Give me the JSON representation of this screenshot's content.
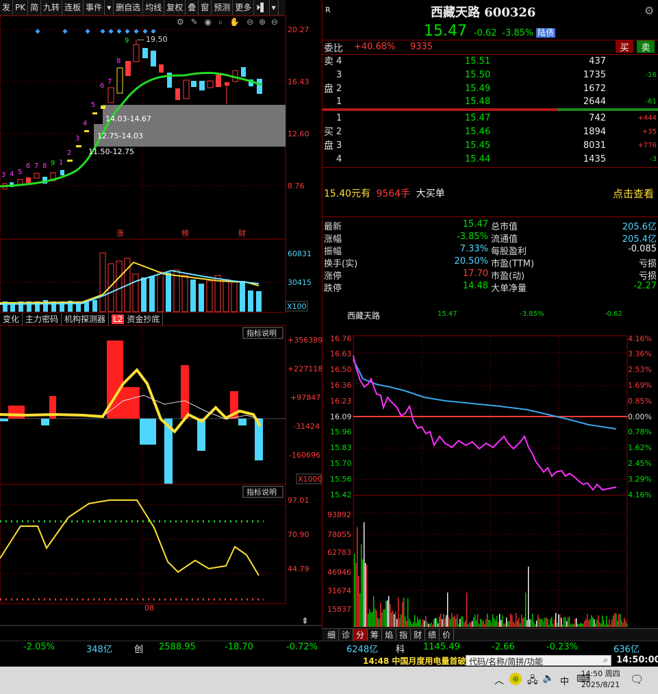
{
  "toolbar": {
    "items": [
      "发",
      "PK",
      "简",
      "九转",
      "连板",
      "事件",
      "▾",
      "|",
      "删自选",
      "均线",
      "复权",
      "叠",
      "窗",
      "预测",
      "更多",
      "⏵▌",
      "▾"
    ]
  },
  "kline": {
    "price_ticks": [
      "20.27",
      "16.43",
      "12.60",
      "8.76"
    ],
    "annotations": {
      "high": "19.50",
      "zone1": "14.03-14.67",
      "zone2": "12.75-14.03",
      "zone3": "11.50-12.75"
    },
    "markers": [
      "涨",
      "榜",
      "财"
    ],
    "nine_counts": [
      "3",
      "4",
      "5",
      "6",
      "7",
      "8",
      "9",
      "1",
      "2",
      "3",
      "4",
      "5",
      "6",
      "7",
      "8",
      "9"
    ]
  },
  "volume": {
    "ticks": [
      "60831",
      "30415"
    ],
    "unit": "X100"
  },
  "indicator_tabs": [
    "变化",
    "主力密码",
    "机构探测器",
    "L2",
    "资金抄底"
  ],
  "flow": {
    "button": "指标说明",
    "ticks": [
      "+356389",
      "+227118",
      "+97847",
      "-31424",
      "-160696"
    ],
    "unit": "X1000"
  },
  "osc": {
    "button": "指标说明",
    "ticks": [
      "97.01",
      "70.90",
      "44.79"
    ],
    "date_label": "08"
  },
  "header": {
    "badge": "R",
    "name": "西藏天路",
    "code": "600326",
    "price": "15.47",
    "change": "-0.62",
    "pct": "-3.85%",
    "tag": "陆债"
  },
  "weibi": {
    "label": "委比",
    "pct": "+40.68%",
    "diff": "9335",
    "buy_btn": "买",
    "sell_btn": "卖"
  },
  "asks": [
    {
      "side": "卖",
      "lvl": "4",
      "price": "15.51",
      "vol": "437",
      "chg": ""
    },
    {
      "side": "",
      "lvl": "3",
      "price": "15.50",
      "vol": "1735",
      "chg": "-16"
    },
    {
      "side": "盘",
      "lvl": "2",
      "price": "15.49",
      "vol": "1672",
      "chg": ""
    },
    {
      "side": "",
      "lvl": "1",
      "price": "15.48",
      "vol": "2644",
      "chg": "-61"
    }
  ],
  "bids": [
    {
      "side": "",
      "lvl": "1",
      "price": "15.47",
      "vol": "742",
      "chg": "+444"
    },
    {
      "side": "买",
      "lvl": "2",
      "price": "15.46",
      "vol": "1894",
      "chg": "+35"
    },
    {
      "side": "盘",
      "lvl": "3",
      "price": "15.45",
      "vol": "8031",
      "chg": "+776"
    },
    {
      "side": "",
      "lvl": "4",
      "price": "15.44",
      "vol": "1435",
      "chg": "-3"
    }
  ],
  "bigorder": {
    "price": "15.40元有",
    "vol": "9564手",
    "text": "大买单",
    "link": "点击查看"
  },
  "stats": [
    {
      "l1": "最新",
      "v1": "15.47",
      "l2": "总市值",
      "v2": "205.6亿"
    },
    {
      "l1": "涨幅",
      "v1": "-3.85%",
      "l2": "流通值",
      "v2": "205.4亿"
    },
    {
      "l1": "振幅",
      "v1": "7.33%",
      "l2": "每股盈利",
      "v2": "-0.085"
    },
    {
      "l1": "换手(实)",
      "v1": "20.50%",
      "l2": "市盈(TTM)",
      "v2": "亏损"
    },
    {
      "l1": "涨停",
      "v1": "17.70",
      "l2": "市盈(动)",
      "v2": "亏损"
    },
    {
      "l1": "跌停",
      "v1": "14.48",
      "l2": "大单净量",
      "v2": "-2.27"
    }
  ],
  "intraday": {
    "name": "西藏天路",
    "price": "15.47",
    "pct": "-3.85%",
    "chg": "-0.62",
    "left_ticks": [
      "16.76",
      "16.63",
      "16.50",
      "16.36",
      "16.23",
      "16.09",
      "15.96",
      "15.83",
      "15.70",
      "15.56",
      "15.42"
    ],
    "right_ticks": [
      "4.16%",
      "3.36%",
      "2.53%",
      "1.69%",
      "0.85%",
      "0.00%",
      "0.78%",
      "1.62%",
      "2.45%",
      "3.29%",
      "4.16%"
    ],
    "vol_ticks": [
      "93892",
      "78055",
      "62783",
      "46946",
      "31674",
      "15837"
    ]
  },
  "bottom_tabs": [
    "细",
    "诊",
    "分",
    "筹",
    "焰",
    "指",
    "财",
    "绩",
    "价"
  ],
  "statusbar": {
    "a": "-2.05%",
    "b": "348亿",
    "c": "创",
    "d": "2588.95",
    "e": "-18.70",
    "f": "-0.72%",
    "g": "6248亿",
    "h": "科",
    "i": "1145.49",
    "j": "-2.66",
    "k": "-0.23%",
    "l": "636亿"
  },
  "ticker": {
    "news": "14:48 中国月度用电量首破",
    "search_placeholder": "代码/名称/简拼/功能",
    "time": "14:50:00"
  },
  "taskbar": {
    "ime": "中",
    "time": "14:50 周四",
    "date": "2025/8/21"
  },
  "colors": {
    "up": "#ff3b3b",
    "down": "#00e000",
    "ma_green": "#22dd22",
    "yellow": "#ffe033",
    "cyan": "#4fd6ff",
    "magenta": "#ff40ff"
  }
}
